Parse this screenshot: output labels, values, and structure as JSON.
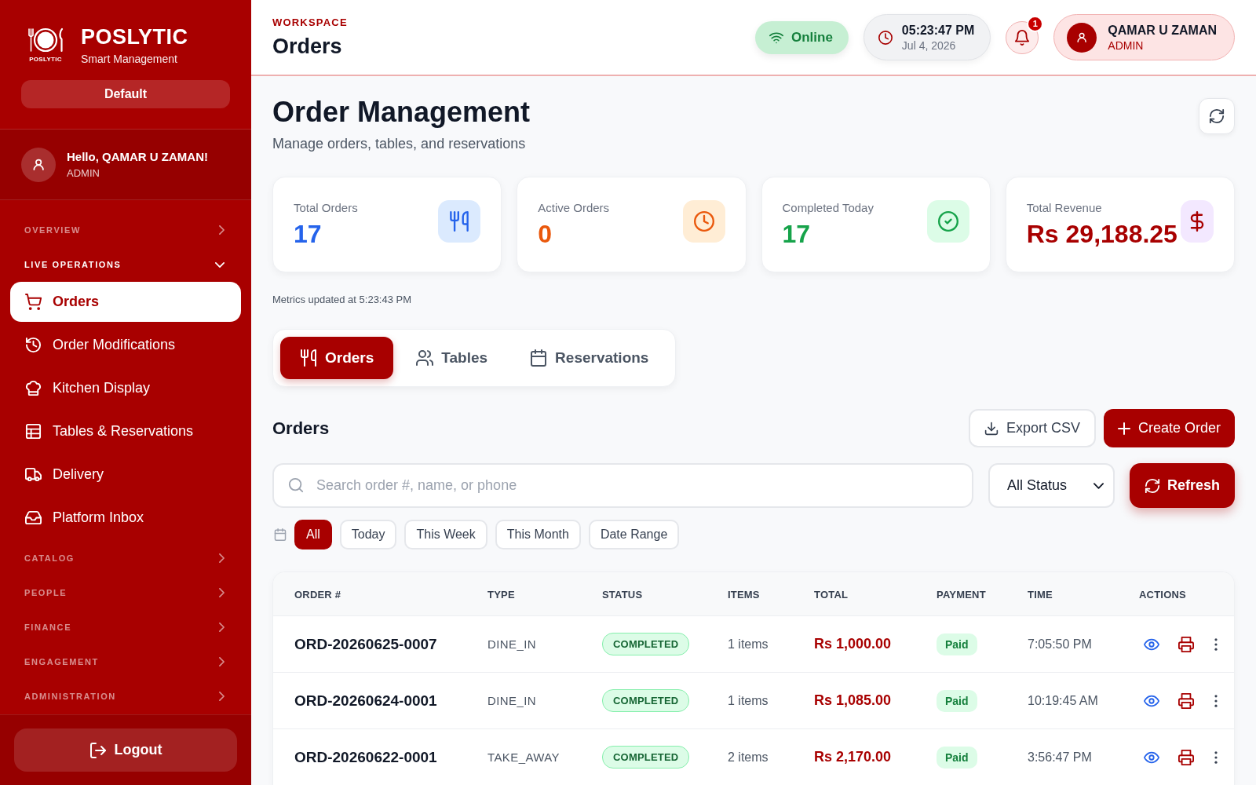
{
  "sidebar": {
    "logo_caption": "POSLYTIC",
    "brand": "POSLYTIC",
    "tagline": "Smart Management",
    "branch_button": "Default",
    "user": {
      "greeting": "Hello, QAMAR U ZAMAN!",
      "role": "ADMIN"
    },
    "sections": [
      {
        "label": "OVERVIEW",
        "expanded": false
      },
      {
        "label": "LIVE OPERATIONS",
        "expanded": true,
        "items": [
          {
            "label": "Orders",
            "selected": true
          },
          {
            "label": "Order Modifications",
            "selected": false
          },
          {
            "label": "Kitchen Display",
            "selected": false
          },
          {
            "label": "Tables & Reservations",
            "selected": false
          },
          {
            "label": "Delivery",
            "selected": false
          },
          {
            "label": "Platform Inbox",
            "selected": false
          }
        ]
      },
      {
        "label": "CATALOG",
        "expanded": false
      },
      {
        "label": "PEOPLE",
        "expanded": false
      },
      {
        "label": "FINANCE",
        "expanded": false
      },
      {
        "label": "ENGAGEMENT",
        "expanded": false
      },
      {
        "label": "ADMINISTRATION",
        "expanded": false
      }
    ],
    "logout_button": "Logout"
  },
  "header": {
    "eyebrow": "WORKSPACE",
    "title": "Orders",
    "connection": "Online",
    "clock": {
      "time": "05:23:47 PM",
      "date": "Jul 4, 2026"
    },
    "notifications": {
      "count": "1"
    },
    "user": {
      "name": "QAMAR U ZAMAN",
      "role": "ADMIN"
    }
  },
  "page": {
    "title": "Order Management",
    "subtitle": "Manage orders, tables, and reservations"
  },
  "stats": [
    {
      "label": "Total Orders",
      "value": "17",
      "color": "#2563eb"
    },
    {
      "label": "Active Orders",
      "value": "0",
      "color": "#ea580c"
    },
    {
      "label": "Completed Today",
      "value": "17",
      "color": "#16a34a"
    },
    {
      "label": "Total Revenue",
      "value": "Rs 29,188.25",
      "color": "#a80000"
    }
  ],
  "metrics_note": "Metrics updated at 5:23:43 PM",
  "view_tabs": [
    {
      "label": "Orders",
      "selected": true
    },
    {
      "label": "Tables",
      "selected": false
    },
    {
      "label": "Reservations",
      "selected": false
    }
  ],
  "orders": {
    "title": "Orders",
    "export_button": "Export CSV",
    "create_button": "Create Order",
    "search": {
      "placeholder": "Search order #, name, or phone"
    },
    "status_filter": "All Status",
    "refresh_button": "Refresh",
    "date_filters": [
      {
        "label": "All",
        "selected": true
      },
      {
        "label": "Today",
        "selected": false
      },
      {
        "label": "This Week",
        "selected": false
      },
      {
        "label": "This Month",
        "selected": false
      },
      {
        "label": "Date Range",
        "selected": false
      }
    ]
  },
  "table": {
    "columns": [
      "ORDER #",
      "TYPE",
      "STATUS",
      "ITEMS",
      "TOTAL",
      "PAYMENT",
      "TIME",
      "ACTIONS"
    ],
    "rows": [
      {
        "order": "ORD-20260625-0007",
        "type": "DINE_IN",
        "status": "COMPLETED",
        "items": "1 items",
        "total": "Rs 1,000.00",
        "payment": "Paid",
        "time": "7:05:50 PM"
      },
      {
        "order": "ORD-20260624-0001",
        "type": "DINE_IN",
        "status": "COMPLETED",
        "items": "1 items",
        "total": "Rs 1,085.00",
        "payment": "Paid",
        "time": "10:19:45 AM"
      },
      {
        "order": "ORD-20260622-0001",
        "type": "TAKE_AWAY",
        "status": "COMPLETED",
        "items": "2 items",
        "total": "Rs 2,170.00",
        "payment": "Paid",
        "time": "3:56:47 PM"
      }
    ]
  }
}
